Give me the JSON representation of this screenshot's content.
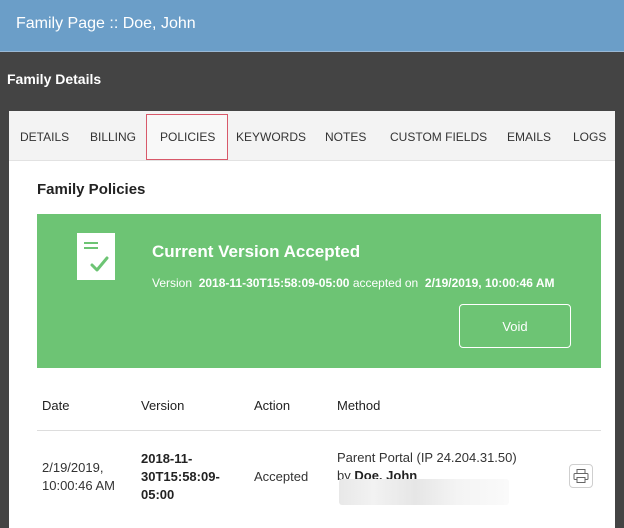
{
  "header": {
    "title": "Family Page :: Doe, John"
  },
  "section": {
    "title": "Family Details"
  },
  "tabs": [
    {
      "label": "DETAILS"
    },
    {
      "label": "BILLING"
    },
    {
      "label": "POLICIES"
    },
    {
      "label": "KEYWORDS"
    },
    {
      "label": "NOTES"
    },
    {
      "label": "CUSTOM FIELDS"
    },
    {
      "label": "EMAILS"
    },
    {
      "label": "LOGS"
    }
  ],
  "active_tab": "POLICIES",
  "policies": {
    "title": "Family Policies",
    "banner": {
      "heading": "Current Version Accepted",
      "version_prefix": "Version",
      "version": "2018-11-30T15:58:09-05:00",
      "accepted_on_label": "accepted on",
      "accepted_on": "2/19/2019, 10:00:46 AM",
      "void_label": "Void",
      "color": "#6dc474"
    },
    "table": {
      "headers": [
        "Date",
        "Version",
        "Action",
        "Method"
      ],
      "rows": [
        {
          "date_line1": "2/19/2019,",
          "date_line2": "10:00:46 AM",
          "version_line1": "2018-11-",
          "version_line2": "30T15:58:09-",
          "version_line3": "05:00",
          "action": "Accepted",
          "method_line1": "Parent Portal (IP 24.204.31.50)",
          "method_by": "by",
          "method_user": "Doe, John",
          "icon": "printer-icon"
        }
      ]
    }
  }
}
